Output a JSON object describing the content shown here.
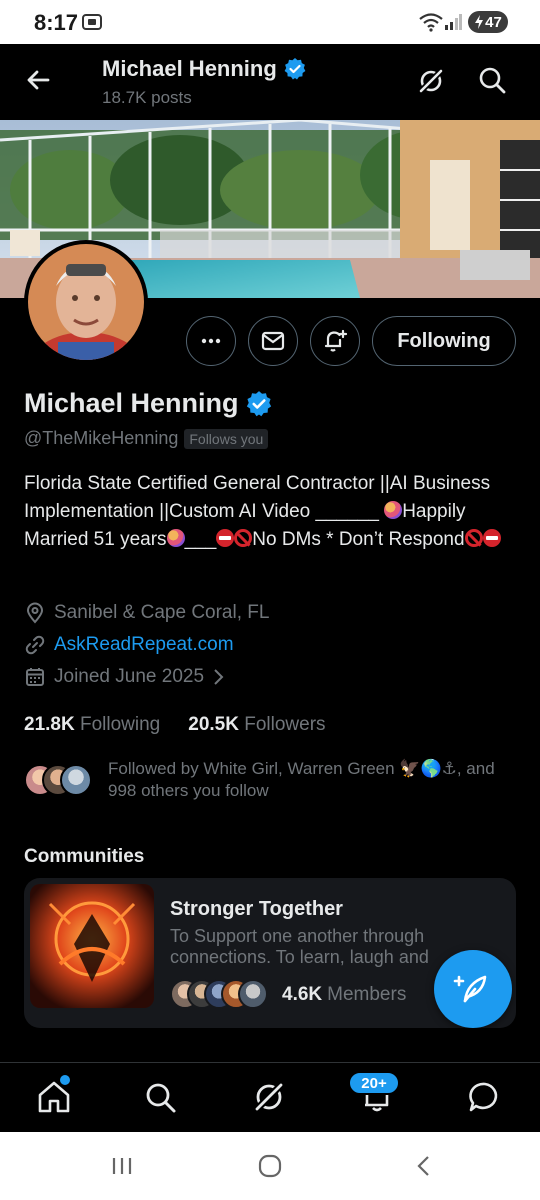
{
  "status_bar": {
    "time": "8:17",
    "battery": "47"
  },
  "header": {
    "name": "Michael Henning",
    "posts": "18.7K posts"
  },
  "profile": {
    "name": "Michael Henning",
    "handle": "@TheMikeHenning",
    "follows_you": "Follows you",
    "bio_line1": "Florida State Certified General Contractor ||AI Business Implementation ||Custom AI Video ______ ",
    "bio_part2": "Happily Married 51 years",
    "bio_part3": "___",
    "bio_part4": "No DMs * Don’t Respond",
    "location": "Sanibel & Cape Coral, FL",
    "website": "AskReadRepeat.com",
    "joined": "Joined June 2025",
    "following_count": "21.8K",
    "following_label": "Following",
    "followers_count": "20.5K",
    "followers_label": "Followers",
    "followed_by": "Followed by White Girl, Warren Green 🦅🌎⚓, and 998 others you follow"
  },
  "actions": {
    "following_button": "Following"
  },
  "communities": {
    "title": "Communities",
    "items": [
      {
        "name": "Stronger Together",
        "description": "To Support one another through connections. To learn, laugh and",
        "member_count": "4.6K",
        "member_label": "Members"
      }
    ]
  },
  "bottom_nav": {
    "notif_badge": "20+"
  },
  "icons": {
    "back": "arrow-left-icon",
    "grok": "grok-icon",
    "search": "search-icon",
    "more": "more-icon",
    "message": "mail-icon",
    "notify": "bell-plus-icon",
    "verified": "verified-badge-icon",
    "location": "location-pin-icon",
    "link": "link-icon",
    "calendar": "calendar-icon",
    "compose": "compose-icon",
    "home": "home-icon",
    "notifications": "bell-icon",
    "messages": "chat-icon"
  },
  "colors": {
    "accent": "#1d9bf0",
    "background": "#000000",
    "text_primary": "#e7e9ea",
    "text_secondary": "#71767b"
  }
}
